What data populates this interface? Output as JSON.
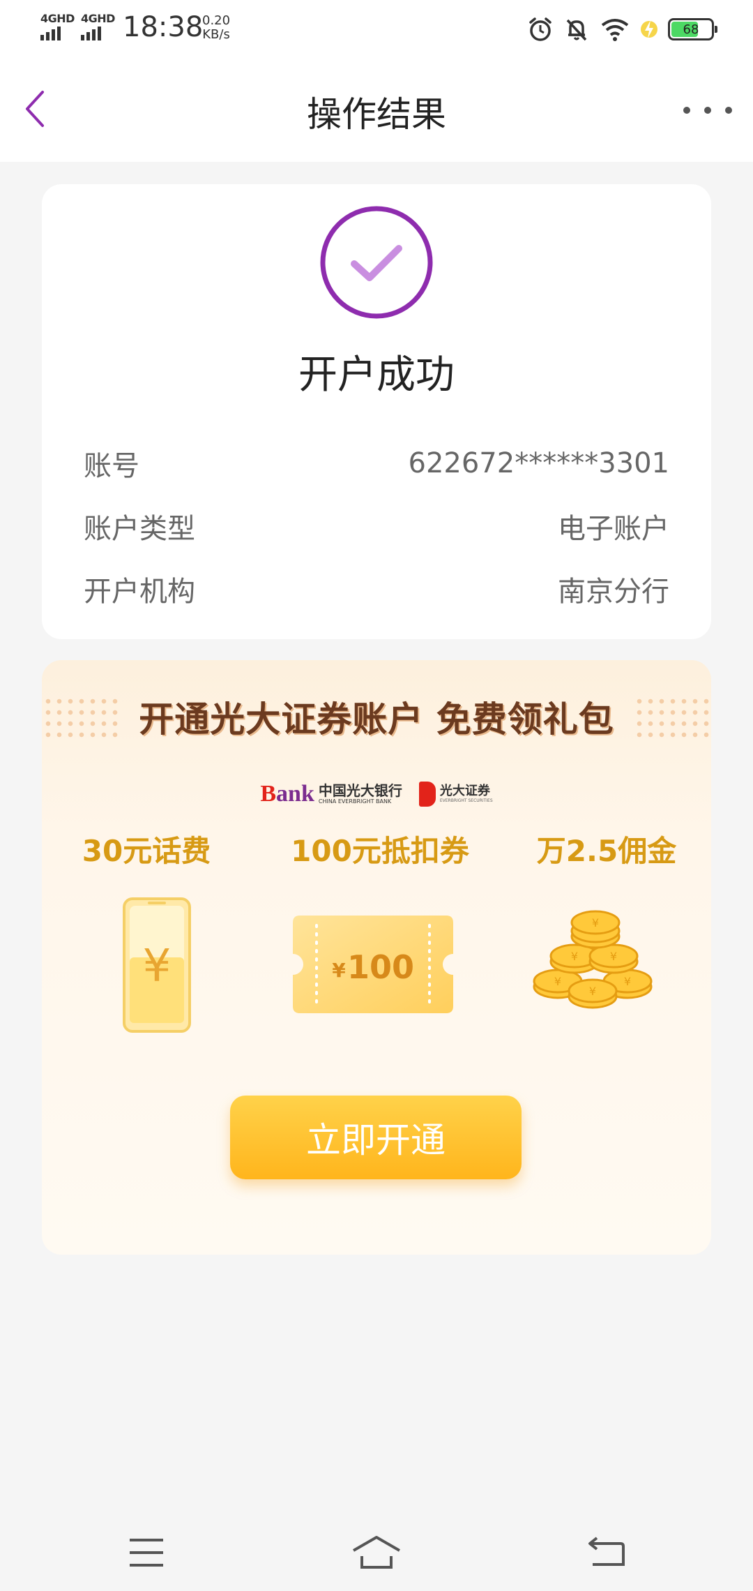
{
  "status_bar": {
    "net1": "4GHD",
    "net2": "4GHD",
    "time": "18:38",
    "speed_value": "0.20",
    "speed_unit": "KB/s",
    "battery": "68",
    "icons": [
      "alarm-icon",
      "mute-icon",
      "wifi-icon",
      "charging-icon",
      "battery-icon"
    ]
  },
  "nav": {
    "title": "操作结果"
  },
  "result": {
    "title": "开户成功",
    "rows": [
      {
        "label": "账号",
        "value": "622672******3301"
      },
      {
        "label": "账户类型",
        "value": "电子账户"
      },
      {
        "label": "开户机构",
        "value": "南京分行"
      }
    ],
    "accent": "#8e2cae"
  },
  "promo": {
    "title": "开通光大证券账户 免费领礼包",
    "bank_logo": {
      "mark_b": "B",
      "mark_rest": "ank",
      "cn": "中国光大银行",
      "en": "CHINA EVERBRIGHT BANK"
    },
    "sec_logo": {
      "cn": "光大证券",
      "en": "EVERBRIGHT SECURITIES"
    },
    "benefits": [
      {
        "label": "30元话费",
        "icon": "phone-yuan-icon"
      },
      {
        "label": "100元抵扣券",
        "icon": "voucher-icon"
      },
      {
        "label": "万2.5佣金",
        "icon": "coins-icon"
      }
    ],
    "phone_symbol": "¥",
    "voucher_symbol": "¥",
    "voucher_amount": "100",
    "button_label": "立即开通",
    "accent": "#ffb51c"
  }
}
